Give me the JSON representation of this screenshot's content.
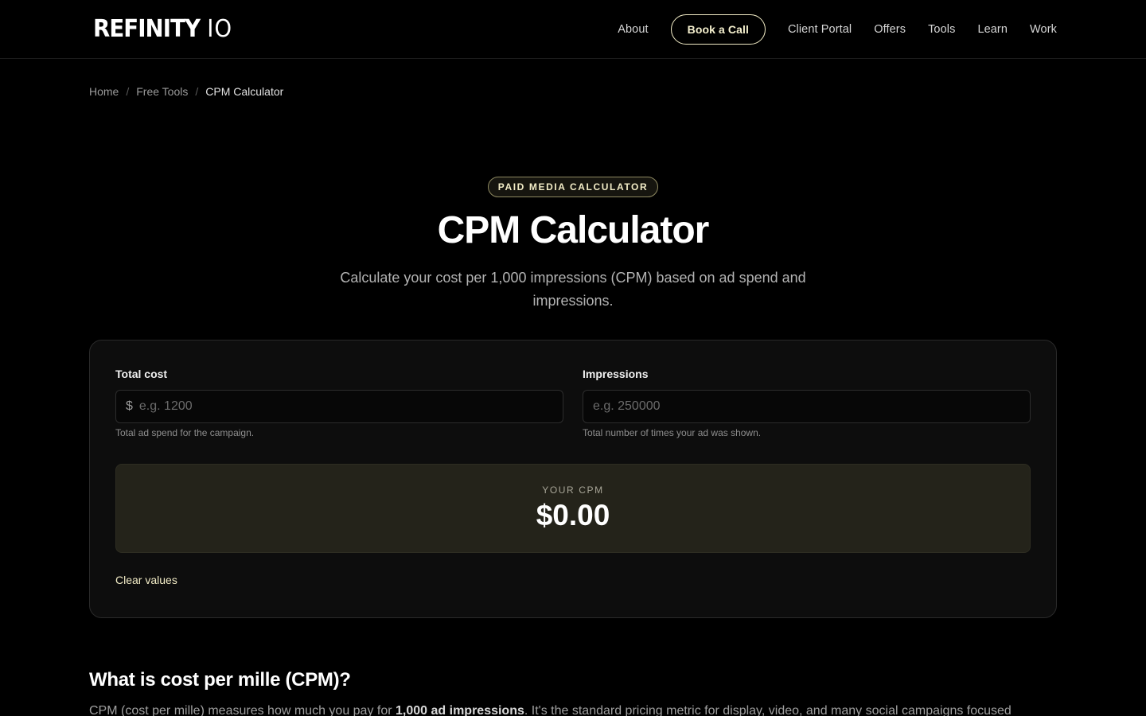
{
  "header": {
    "logo_text": "REFINITY",
    "logo_suffix": "IO",
    "nav": {
      "about": "About",
      "book_call": "Book a Call",
      "client_portal": "Client Portal",
      "offers": "Offers",
      "tools": "Tools",
      "learn": "Learn",
      "work": "Work"
    }
  },
  "breadcrumb": {
    "home": "Home",
    "free_tools": "Free Tools",
    "current": "CPM Calculator",
    "separator": "/"
  },
  "hero": {
    "badge": "PAID MEDIA CALCULATOR",
    "title": "CPM Calculator",
    "subtitle": "Calculate your cost per 1,000 impressions (CPM) based on ad spend and impressions."
  },
  "calculator": {
    "total_cost": {
      "label": "Total cost",
      "prefix": "$",
      "placeholder": "e.g. 1200",
      "value": "",
      "help": "Total ad spend for the campaign."
    },
    "impressions": {
      "label": "Impressions",
      "placeholder": "e.g. 250000",
      "value": "",
      "help": "Total number of times your ad was shown."
    },
    "result": {
      "label": "YOUR CPM",
      "value": "$0.00"
    },
    "clear_label": "Clear values"
  },
  "info": {
    "heading": "What is cost per mille (CPM)?",
    "intro_before": "CPM (cost per mille) measures how much you pay for ",
    "intro_strong": "1,000 ad impressions",
    "intro_after": ". It's the standard pricing metric for display, video, and many social campaigns focused"
  },
  "colors": {
    "background": "#000000",
    "accent": "#f2ecc6",
    "result_bg": "#24231a",
    "card_bg": "#0d0d0d"
  }
}
